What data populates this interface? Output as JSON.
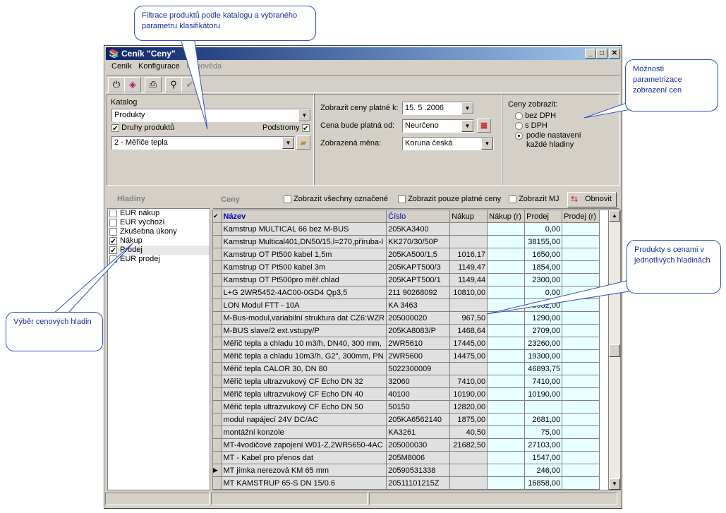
{
  "callouts": {
    "filter": "Filtrace produktů podle katalogu a vybraného parametru klasifikátoru",
    "display": "Možnosti parametrizace zobrazení cen",
    "products": "Produkty s cenami v jednotlivých hladinách",
    "levels": "Výběr cenových hladin"
  },
  "window": {
    "title": "Ceník \"Ceny\"",
    "menu": [
      "Ceník",
      "Konfigurace",
      "Nápověda"
    ]
  },
  "catalog": {
    "label": "Katalog",
    "value": "Produkty",
    "product_types_label": "Druhy produktů",
    "subtrees_label": "Podstromy",
    "type_value": "2 - Měřiče tepla"
  },
  "validity": {
    "valid_to_label": "Zobrazit ceny platné k:",
    "valid_to_value": "15. 5 .2006",
    "valid_from_label": "Cena bude platná od:",
    "valid_from_value": "Neurčeno",
    "currency_label": "Zobrazená měna:",
    "currency_value": "Koruna česká"
  },
  "price_display": {
    "label": "Ceny zobrazit:",
    "options": [
      "bez DPH",
      "s DPH",
      "podle nastavení každé hladiny"
    ],
    "selected": 2
  },
  "levels": {
    "header": "Hladiny",
    "items": [
      {
        "label": "EUR nákup",
        "checked": false
      },
      {
        "label": "EUR výchozí",
        "checked": false
      },
      {
        "label": "Zkušebna úkony",
        "checked": false
      },
      {
        "label": "Nákup",
        "checked": true
      },
      {
        "label": "Prodej",
        "checked": true
      },
      {
        "label": "EUR prodej",
        "checked": false
      }
    ]
  },
  "prices": {
    "header": "Ceny",
    "show_all_marked": "Zobrazit všechny označené",
    "show_only_valid": "Zobrazit pouze platné ceny",
    "show_mj": "Zobrazit MJ",
    "refresh": "Obnovit",
    "columns": [
      "Název",
      "Číslo",
      "Nákup",
      "Nákup (r)",
      "Prodej",
      "Prodej (r)"
    ],
    "rows": [
      [
        "Kamstrup MULTICAL 66 bez M-BUS",
        "205KA3400",
        "",
        "",
        "0,00",
        ""
      ],
      [
        "Kamstrup Multical401,DN50/15,l=270,příruba-l",
        "KK270/30/50P",
        "",
        "",
        "38155,00",
        ""
      ],
      [
        "Kamstrup OT Pt500 kabel 1,5m",
        "205KA500/1,5",
        "1016,17",
        "",
        "1650,00",
        ""
      ],
      [
        "Kamstrup OT Pt500 kabel 3m",
        "205KAPT500/3",
        "1149,47",
        "",
        "1854,00",
        ""
      ],
      [
        "Kamstrup OT Pt500pro měř.chlad",
        "205KAPT500/1",
        "1149,44",
        "",
        "2300,00",
        ""
      ],
      [
        "L+G 2WR5452-4AC00-0GD4 Qp3,5",
        "211 90268092",
        "10810,00",
        "",
        "0,00",
        ""
      ],
      [
        "LON Modul FTT - 10A",
        "KA 3463",
        "",
        "",
        "5032,00",
        ""
      ],
      [
        "M-Bus-modul,variabilní struktura dat CZ6:WZR",
        "205000020",
        "967,50",
        "",
        "1290,00",
        ""
      ],
      [
        "M-BUS slave/2 ext.vstupy/P",
        "205KA8083/P",
        "1468,64",
        "",
        "2709,00",
        ""
      ],
      [
        "Měřič tepla a chladu 10 m3/h, DN40, 300 mm,",
        "2WR5610",
        "17445,00",
        "",
        "23260,00",
        ""
      ],
      [
        "Měřič tepla a chladu 10m3/h, G2\", 300mm, PN",
        "2WR5600",
        "14475,00",
        "",
        "19300,00",
        ""
      ],
      [
        "Měřič tepla CALOR 30, DN 80",
        "5022300009",
        "",
        "",
        "46893,75",
        ""
      ],
      [
        "Měřič tepla ultrazvukový CF Echo DN 32",
        "32060",
        "7410,00",
        "",
        "7410,00",
        ""
      ],
      [
        "Měřič tepla ultrazvukový CF Echo DN 40",
        "40100",
        "10190,00",
        "",
        "10190,00",
        ""
      ],
      [
        "Měřič tepla ultrazvukový CF Echo DN 50",
        "50150",
        "12820,00",
        "",
        "",
        ""
      ],
      [
        "modul napájecí 24V DC/AC",
        "205KA6562140",
        "1875,00",
        "",
        "2681,00",
        ""
      ],
      [
        "montážní konzole",
        "KA3261",
        "40,50",
        "",
        "75,00",
        ""
      ],
      [
        "MT-4vodičové zapojení W01-Z,2WR5650-4AC",
        "205000030",
        "21682,50",
        "",
        "27103,00",
        ""
      ],
      [
        "MT - Kabel pro přenos dat",
        "205M8006",
        "",
        "",
        "1547,00",
        ""
      ],
      [
        "MT jímka nerezová KM 65 mm",
        "20590531338",
        "",
        "",
        "246,00",
        ""
      ],
      [
        "MT KAMSTRUP 65-S DN 15/0.6",
        "20511101215Z",
        "",
        "",
        "16858,00",
        ""
      ]
    ],
    "current_row": 19
  }
}
